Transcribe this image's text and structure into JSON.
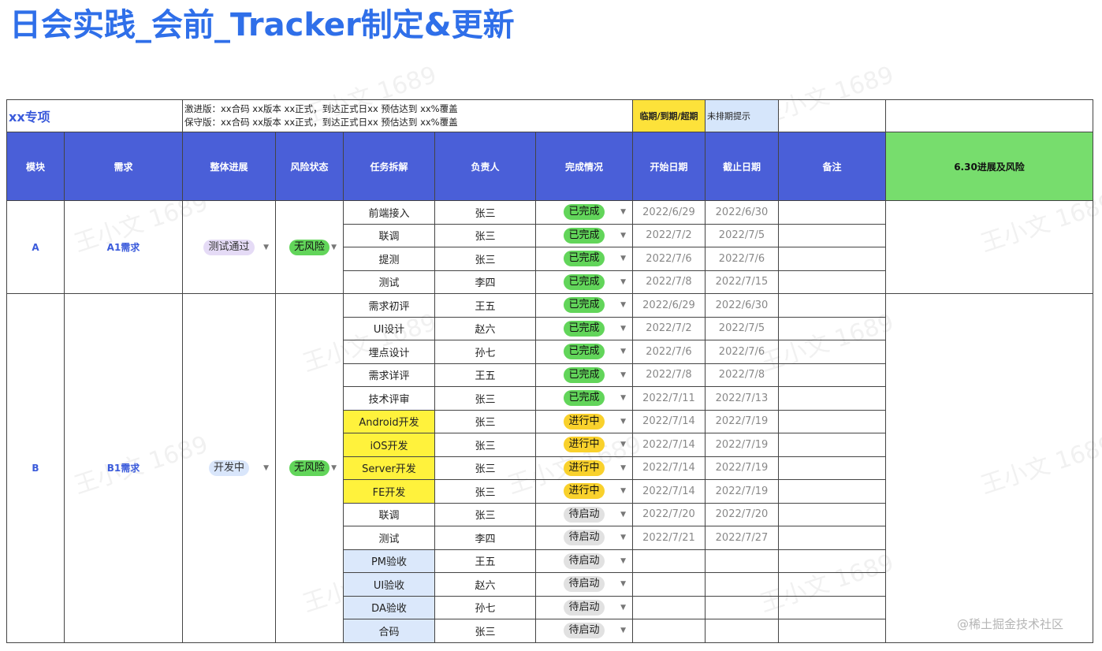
{
  "page_title": "日会实践_会前_Tracker制定&更新",
  "watermark": "王小文 1689",
  "footer": "@稀土掘金技术社区",
  "project": {
    "name": "xx专项",
    "note_aggressive": "激进版：xx合码 xx版本 xx正式，到达正式日xx 预估达到 xx%覆盖",
    "note_conservative": "保守版：xx合码 xx版本 xx正式，到达正式日xx 预估达到 xx%覆盖",
    "legend_due": "临期/到期/超期",
    "legend_unscheduled": "未排期提示"
  },
  "colors": {
    "title": "#2f6fe9",
    "header_bg": "#4a5fd8",
    "header_green": "#77dd6d",
    "legend_yellow": "#fde23a",
    "legend_blue": "#d6e6fb",
    "done_green": "#62d55a",
    "inprogress_yellow": "#f9d12c",
    "pending_gray": "#e1e1e1"
  },
  "headers": {
    "module": "模块",
    "requirement": "需求",
    "overall": "整体进展",
    "risk": "风险状态",
    "task": "任务拆解",
    "owner": "负责人",
    "status": "完成情况",
    "start": "开始日期",
    "end": "截止日期",
    "remark": "备注",
    "progress": "6.30进展及风险"
  },
  "groups": [
    {
      "module": "A",
      "requirement": "A1需求",
      "overall": "测试通过",
      "risk": "无风险",
      "tasks": [
        {
          "task": "前端接入",
          "owner": "张三",
          "status": "已完成",
          "start": "2022/6/29",
          "end": "2022/6/30"
        },
        {
          "task": "联调",
          "owner": "张三",
          "status": "已完成",
          "start": "2022/7/2",
          "end": "2022/7/5"
        },
        {
          "task": "提测",
          "owner": "张三",
          "status": "已完成",
          "start": "2022/7/6",
          "end": "2022/7/6"
        },
        {
          "task": "测试",
          "owner": "李四",
          "status": "已完成",
          "start": "2022/7/8",
          "end": "2022/7/15"
        }
      ]
    },
    {
      "module": "B",
      "requirement": "B1需求",
      "overall": "开发中",
      "risk": "无风险",
      "tasks": [
        {
          "task": "需求初评",
          "owner": "王五",
          "status": "已完成",
          "start": "2022/6/29",
          "end": "2022/6/30"
        },
        {
          "task": "UI设计",
          "owner": "赵六",
          "status": "已完成",
          "start": "2022/7/2",
          "end": "2022/7/5"
        },
        {
          "task": "埋点设计",
          "owner": "孙七",
          "status": "已完成",
          "start": "2022/7/6",
          "end": "2022/7/6"
        },
        {
          "task": "需求详评",
          "owner": "王五",
          "status": "已完成",
          "start": "2022/7/8",
          "end": "2022/7/8"
        },
        {
          "task": "技术评审",
          "owner": "张三",
          "status": "已完成",
          "start": "2022/7/11",
          "end": "2022/7/13"
        },
        {
          "task": "Android开发",
          "owner": "张三",
          "status": "进行中",
          "start": "2022/7/14",
          "end": "2022/7/19",
          "highlight": "yellow"
        },
        {
          "task": "iOS开发",
          "owner": "张三",
          "status": "进行中",
          "start": "2022/7/14",
          "end": "2022/7/19",
          "highlight": "yellow"
        },
        {
          "task": "Server开发",
          "owner": "张三",
          "status": "进行中",
          "start": "2022/7/14",
          "end": "2022/7/19",
          "highlight": "yellow"
        },
        {
          "task": "FE开发",
          "owner": "张三",
          "status": "进行中",
          "start": "2022/7/14",
          "end": "2022/7/19",
          "highlight": "yellow"
        },
        {
          "task": "联调",
          "owner": "张三",
          "status": "待启动",
          "start": "2022/7/20",
          "end": "2022/7/20"
        },
        {
          "task": "测试",
          "owner": "李四",
          "status": "待启动",
          "start": "2022/7/21",
          "end": "2022/7/27"
        },
        {
          "task": "PM验收",
          "owner": "王五",
          "status": "待启动",
          "start": "",
          "end": "",
          "highlight": "blue"
        },
        {
          "task": "UI验收",
          "owner": "赵六",
          "status": "待启动",
          "start": "",
          "end": "",
          "highlight": "blue"
        },
        {
          "task": "DA验收",
          "owner": "孙七",
          "status": "待启动",
          "start": "",
          "end": "",
          "highlight": "blue"
        },
        {
          "task": "合码",
          "owner": "张三",
          "status": "待启动",
          "start": "",
          "end": "",
          "highlight": "blue"
        }
      ]
    }
  ]
}
